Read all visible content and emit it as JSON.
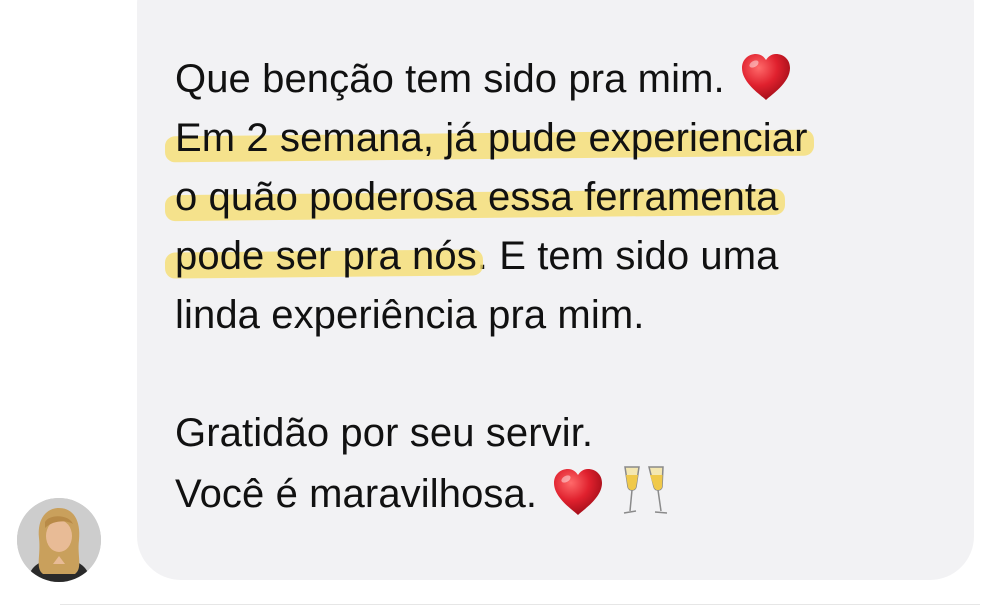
{
  "message": {
    "line1": "Que benção tem sido pra mim.",
    "line2": "Em 2 semana, já pude experienciar",
    "line3": "o quão poderosa essa ferramenta",
    "line4_highlight": "pode ser pra nós",
    "line4_rest": ". E tem sido uma",
    "line5": "linda experiência pra mim.",
    "line6": "Gratidão por seu servir.",
    "line7": "Você é maravilhosa."
  },
  "emojis": {
    "heart": "red-heart-icon",
    "glasses": "champagne-glasses-icon"
  },
  "colors": {
    "bubble": "#f2f2f4",
    "highlight": "#f6de6e",
    "text": "#111111",
    "heart": "#e0212e"
  }
}
